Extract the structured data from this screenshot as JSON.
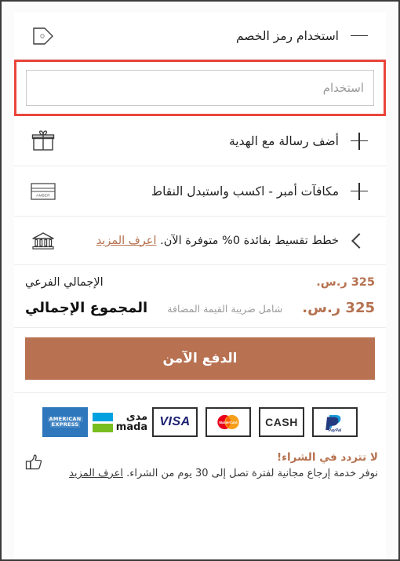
{
  "coupon": {
    "title": "استخدام رمز الخصم",
    "icon": "discount-tag-icon",
    "toggle": "minus-icon",
    "input_placeholder": "استخدام",
    "input_value": "",
    "highlight_color": "#ea453b"
  },
  "gift": {
    "title": "أضف رسالة مع الهدية",
    "icon": "gift-icon",
    "toggle": "plus-icon"
  },
  "amber": {
    "title": "مكافآت أمبر - اكسب واستبدل النقاط",
    "icon": "amber-card-icon",
    "card_label": "AMBER",
    "toggle": "plus-icon"
  },
  "installments": {
    "icon": "bank-icon",
    "text": "خطط تقسيط بفائدة 0% متوفرة الآن.",
    "link": "اعرف المزيد",
    "chevron": "chevron-left-icon"
  },
  "totals": {
    "subtotal_label": "الإجمالي الفرعي",
    "subtotal_value": "325 ر.س.",
    "grand_label": "المجموع الإجمالي",
    "vat_note": "شامل ضريبة القيمة المضافة",
    "grand_value": "325 ر.س.",
    "accent_color": "#b5714f"
  },
  "checkout": {
    "label": "الدفع الآمن",
    "color": "#b87252"
  },
  "payments": [
    {
      "name": "paypal",
      "label": "PayPal"
    },
    {
      "name": "cash",
      "label": "CASH"
    },
    {
      "name": "mastercard",
      "label": "MasterCard"
    },
    {
      "name": "visa",
      "label": "VISA"
    },
    {
      "name": "mada",
      "label_ar": "مدى",
      "label_en": "mada"
    },
    {
      "name": "amex",
      "label_l1": "AMERICAN",
      "label_l2": "EXPRESS"
    }
  ],
  "promise": {
    "icon": "thumbs-up-icon",
    "heading": "لا تتردد في الشراء!",
    "text": "نوفر خدمة إرجاع مجانية لفترة تصل إلى 30 يوم من الشراء.",
    "link": "اعرف المزيد"
  }
}
